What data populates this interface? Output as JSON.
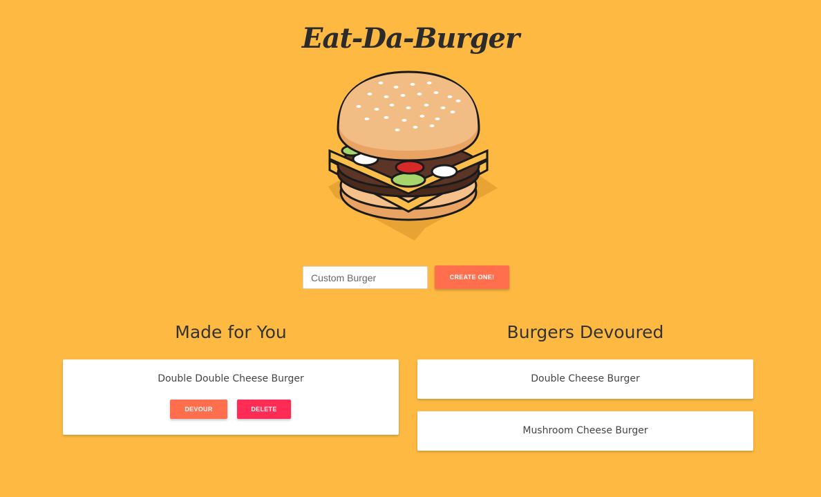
{
  "header": {
    "title": "Eat-Da-Burger"
  },
  "form": {
    "placeholder": "Custom Burger",
    "create_label": "Create One!"
  },
  "made_for_you": {
    "title": "Made for You",
    "items": [
      {
        "name": "Double Double Cheese Burger",
        "devour_label": "Devour",
        "delete_label": "Delete"
      }
    ]
  },
  "devoured": {
    "title": "Burgers Devoured",
    "items": [
      {
        "name": "Double Cheese Burger"
      },
      {
        "name": "Mushroom Cheese Burger"
      }
    ]
  },
  "colors": {
    "background": "#fdb942",
    "create_button": "#ff6f4e",
    "devour_button": "#ff6f4e",
    "delete_button": "#ff2d55"
  }
}
